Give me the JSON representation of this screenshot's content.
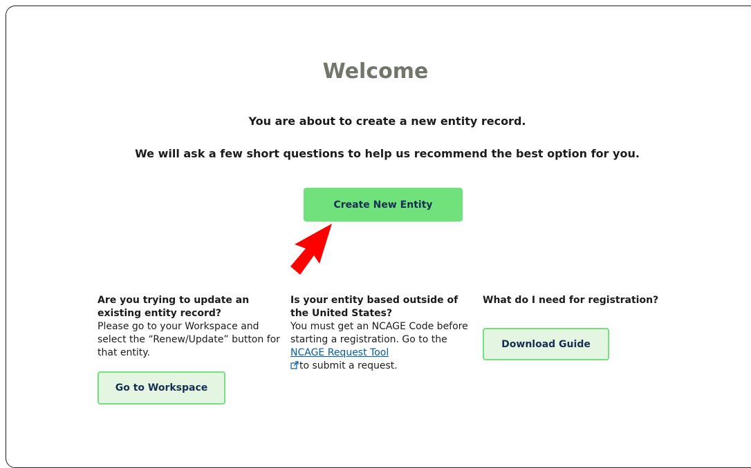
{
  "welcome": {
    "title": "Welcome",
    "line1": "You are about to create a new entity record.",
    "line2": "We will ask a few short questions to help us recommend the best option for you.",
    "create_button": "Create New Entity"
  },
  "col_update": {
    "question": "Are you trying to update an existing entity record?",
    "text": "Please go to your Workspace and select the “Renew/Update” button for that entity.",
    "button": "Go to Workspace"
  },
  "col_outside": {
    "question": "Is your entity based outside of the United States?",
    "text_before": "You must get an NCAGE Code before starting a registration. Go to the ",
    "link": "NCAGE Request Tool",
    "text_after": "to submit a request."
  },
  "col_need": {
    "question": "What do I need for registration?",
    "button": "Download Guide"
  },
  "icons": {
    "annotation_arrow": "red-arrow-icon",
    "external_link": "external-link-icon"
  },
  "colors": {
    "title": "#71766a",
    "primary_button": "#70e17b",
    "button_text": "#162e51",
    "outline_button_bg": "#e4f6e1",
    "link": "#005ea2",
    "annotation_arrow": "#ff0000"
  }
}
